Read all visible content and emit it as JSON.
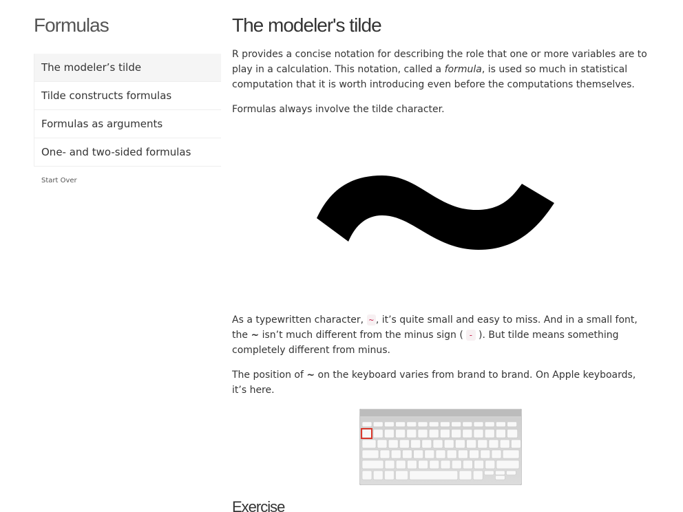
{
  "sidebar": {
    "title": "Formulas",
    "items": [
      {
        "label": "The modeler’s tilde"
      },
      {
        "label": "Tilde constructs formulas"
      },
      {
        "label": "Formulas as arguments"
      },
      {
        "label": "One- and two-sided formulas"
      }
    ],
    "start_over": "Start Over"
  },
  "main": {
    "title": "The modeler's tilde",
    "p1": {
      "before": "R provides a concise notation for describing the role that one or more variables are to play in a calculation. This notation, called a ",
      "emph": "formula",
      "after": ", is used so much in statistical computation that it is worth introducing even before the computations themselves."
    },
    "p2": "Formulas always involve the tilde character.",
    "p3": {
      "part1": "As a typewritten character, ",
      "code1": "~",
      "part2": ", it’s quite small and easy to miss. And in a small font, the ",
      "tilde": "~",
      "part3": " isn’t much different from the minus sign ( ",
      "code2": "-",
      "part4": " ). But tilde means something completely different from minus."
    },
    "p4": {
      "part1": "The position of ",
      "tilde": "~",
      "part2": " on the keyboard varies from brand to brand. On Apple keyboards, it’s here."
    },
    "exercise_heading": "Exercise"
  },
  "colors": {
    "code_text": "#c7254e",
    "code_bg": "#f7f0f2",
    "highlight_key": "#d9382c",
    "active_nav_bg": "#f5f5f5"
  },
  "icons": {
    "big_tilde": "tilde-glyph-image",
    "keyboard": "apple-keyboard-image"
  }
}
